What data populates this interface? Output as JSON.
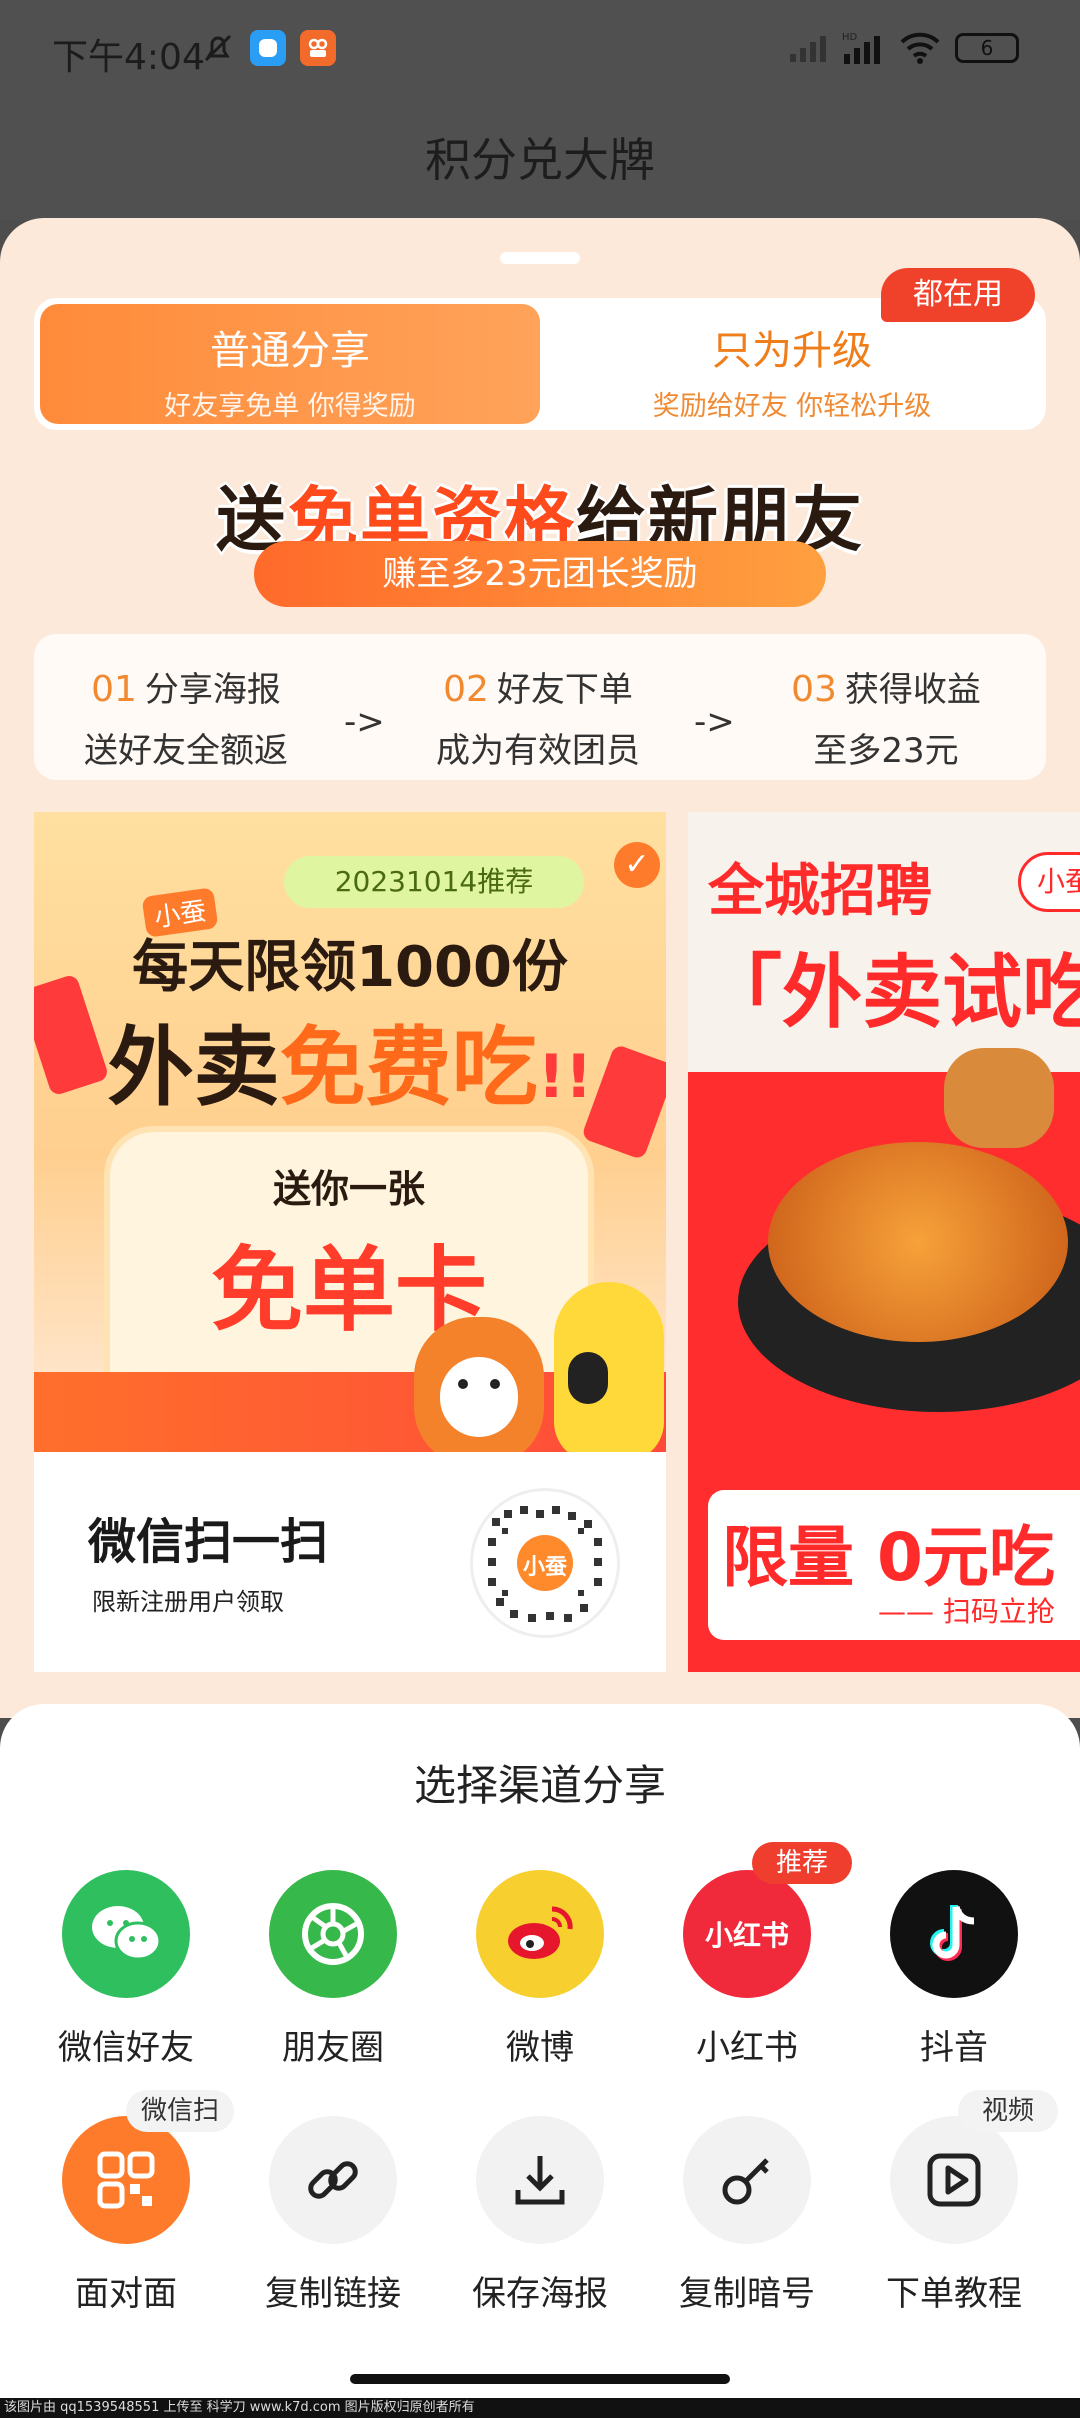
{
  "status": {
    "time": "下午4:04",
    "battery": "6",
    "network": "HD"
  },
  "title": "积分兑大牌",
  "tabs": [
    {
      "label": "普通分享",
      "sub": "好友享免单 你得奖励"
    },
    {
      "label": "只为升级",
      "sub": "奖励给好友 你轻松升级"
    }
  ],
  "tab_badge": "都在用",
  "hero": {
    "part1": "送",
    "highlight": "免单资格",
    "part2": "给新朋友",
    "sub": "赚至多23元团长奖励"
  },
  "steps": [
    {
      "num": "01",
      "title": "分享海报",
      "desc": "送好友全额返"
    },
    {
      "num": "02",
      "title": "好友下单",
      "desc": "成为有效团员"
    },
    {
      "num": "03",
      "title": "获得收益",
      "desc": "至多23元"
    }
  ],
  "step_arrow": "->",
  "poster1": {
    "date_tag": "20231014推荐",
    "brand": "小蚕",
    "line1": "每天限领1000份",
    "line2a": "外卖",
    "line2b": "免费吃",
    "line2c": "!!",
    "card_title": "送你一张",
    "card_main": "免单卡",
    "scan": "微信扫一扫",
    "note": "限新注册用户领取",
    "qr_brand": "小蚕"
  },
  "poster2": {
    "title": "全城招聘",
    "brand": "小蚕",
    "headline": "「外卖试吃",
    "bottom": "限量 0元吃",
    "bottom_sub": "—— 扫码立抢"
  },
  "share": {
    "title": "选择渠道分享",
    "row1": [
      {
        "label": "微信好友",
        "icon": "wechat-icon",
        "color": "#2fbf5f"
      },
      {
        "label": "朋友圈",
        "icon": "moments-icon",
        "color": "#36b84a"
      },
      {
        "label": "微博",
        "icon": "weibo-icon",
        "color": "#f7cf2f"
      },
      {
        "label": "小红书",
        "icon": "xiaohongshu-icon",
        "color": "#f02a3a",
        "tag": "推荐",
        "glyph": "小红书"
      },
      {
        "label": "抖音",
        "icon": "douyin-icon",
        "color": "#111111"
      }
    ],
    "row2": [
      {
        "label": "面对面",
        "icon": "qr-grid-icon",
        "color": "#ff7b2c",
        "tag": "微信扫"
      },
      {
        "label": "复制链接",
        "icon": "link-icon",
        "color": "#f2f2f2"
      },
      {
        "label": "保存海报",
        "icon": "download-icon",
        "color": "#f2f2f2"
      },
      {
        "label": "复制暗号",
        "icon": "key-icon",
        "color": "#f2f2f2"
      },
      {
        "label": "下单教程",
        "icon": "video-icon",
        "color": "#f2f2f2",
        "tag": "视频"
      }
    ]
  },
  "footer": "该图片由 qq1539548551 上传至 科学刀 www.k7d.com 图片版权归原创者所有"
}
